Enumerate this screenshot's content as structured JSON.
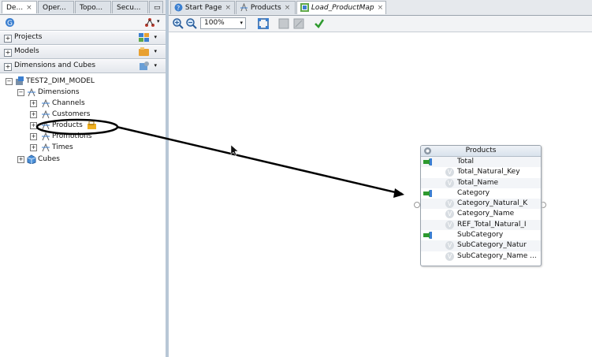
{
  "left_tabs": [
    {
      "label": "De..."
    },
    {
      "label": "Oper..."
    },
    {
      "label": "Topo..."
    },
    {
      "label": "Secu..."
    }
  ],
  "accordion": {
    "projects": "Projects",
    "models": "Models",
    "dimensions": "Dimensions and Cubes"
  },
  "tree": {
    "root": "TEST2_DIM_MODEL",
    "dimensions": "Dimensions",
    "items": [
      "Channels",
      "Customers",
      "Products",
      "Promotions",
      "Times"
    ],
    "cubes": "Cubes"
  },
  "right_tabs": [
    {
      "label": "Start Page"
    },
    {
      "label": "Products"
    },
    {
      "label": "Load_ProductMap"
    }
  ],
  "toolbar": {
    "zoom": "100%"
  },
  "entity": {
    "title": "Products",
    "rows": [
      {
        "label": "Total",
        "kind": "level"
      },
      {
        "label": "Total_Natural_Key",
        "kind": "attr"
      },
      {
        "label": "Total_Name",
        "kind": "attr"
      },
      {
        "label": "Category",
        "kind": "level"
      },
      {
        "label": "Category_Natural_K",
        "kind": "attr"
      },
      {
        "label": "Category_Name",
        "kind": "attr"
      },
      {
        "label": "REF_Total_Natural_I",
        "kind": "attr"
      },
      {
        "label": "SubCategory",
        "kind": "level"
      },
      {
        "label": "SubCategory_Natur",
        "kind": "attr"
      },
      {
        "label": "SubCategory_Name ...",
        "kind": "attr"
      }
    ]
  },
  "colors": {
    "accent": "#2a6ebb",
    "splitter": "#b8c7d6",
    "check": "#2e9a2e"
  }
}
